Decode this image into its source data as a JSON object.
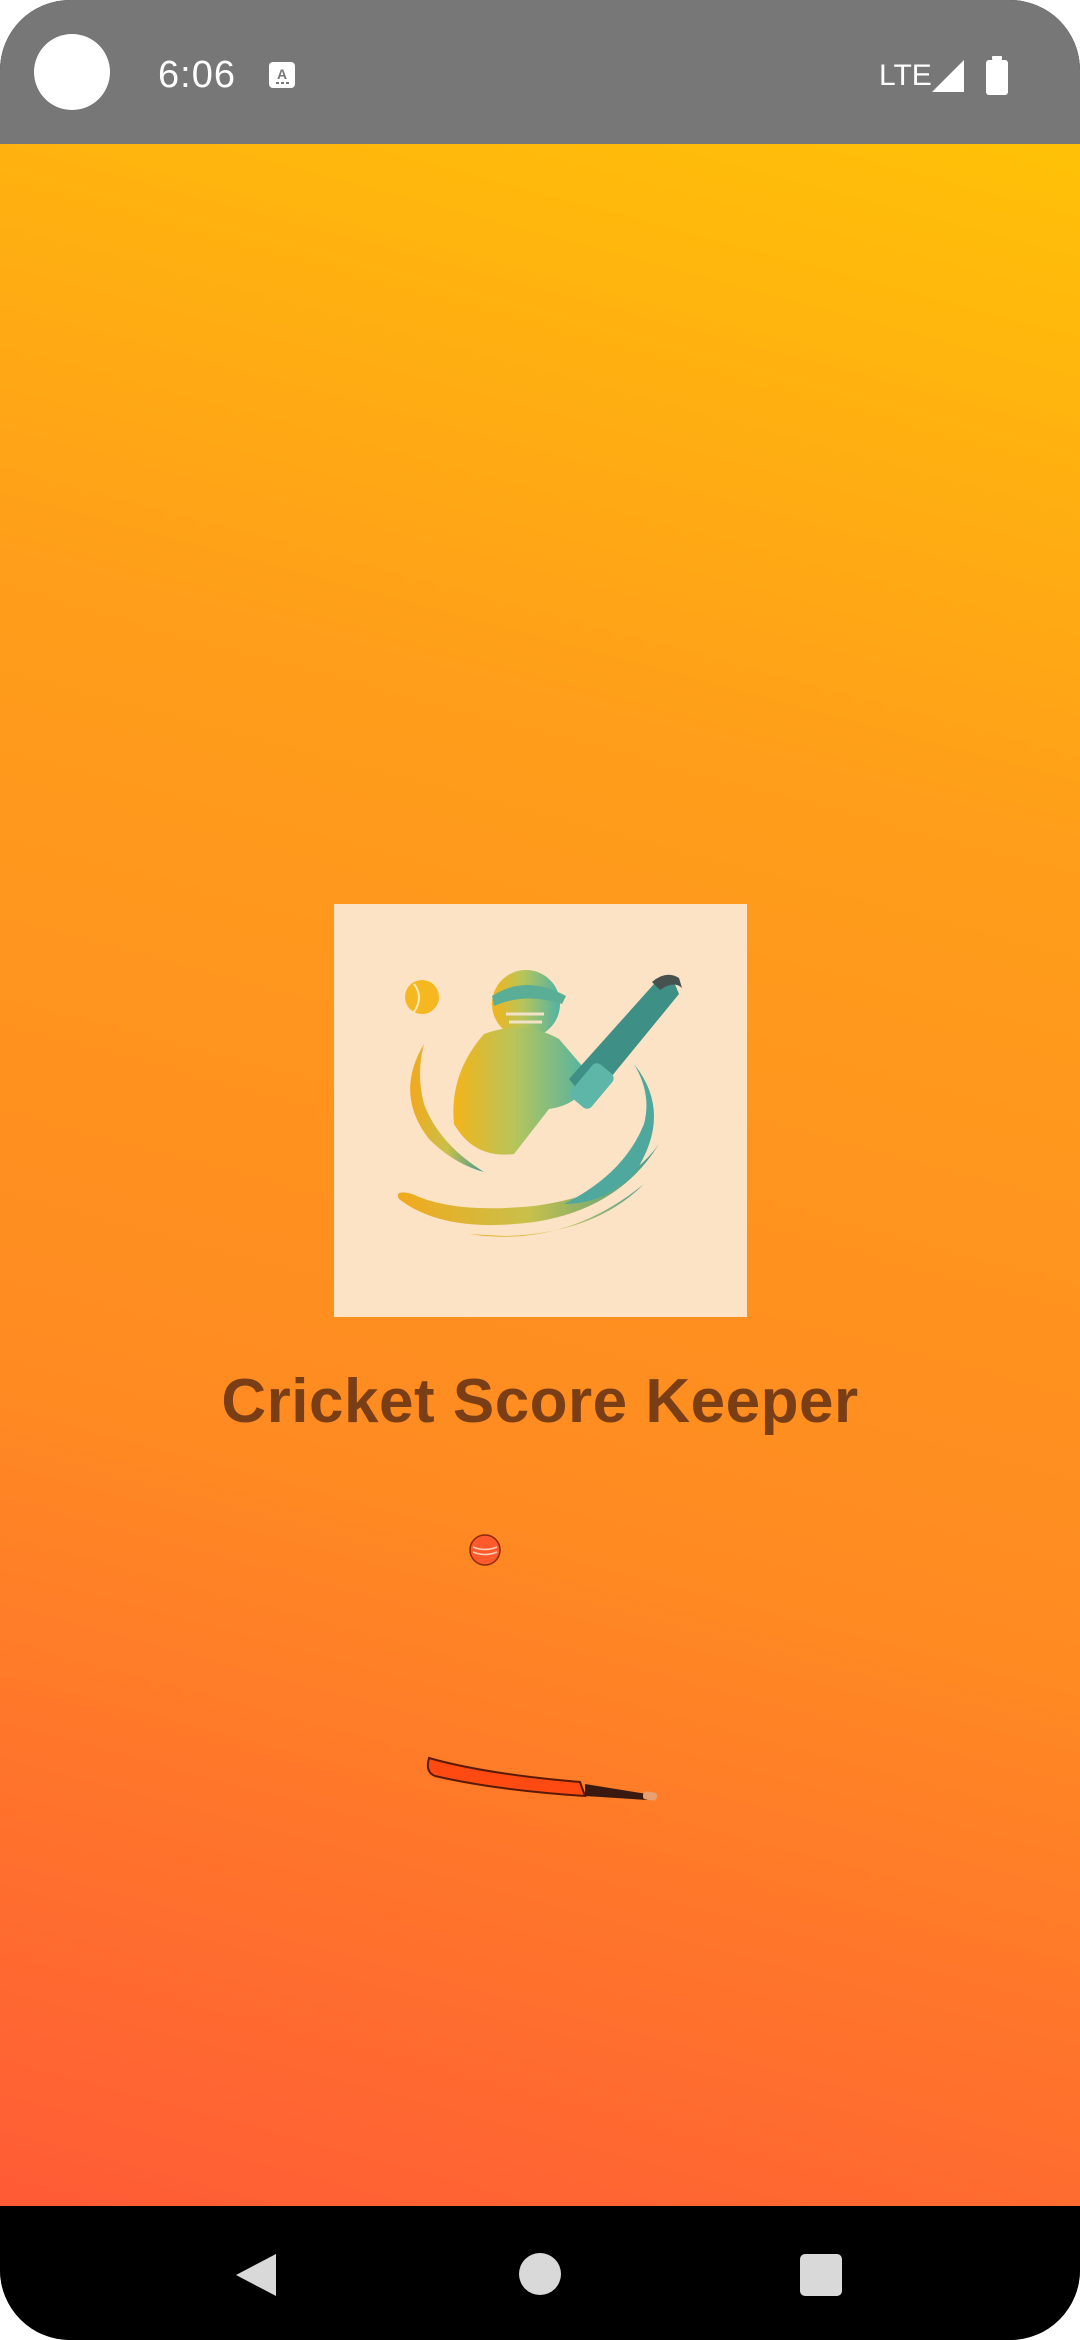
{
  "status_bar": {
    "time": "6:06",
    "notification_icon": "keyboard-a-icon",
    "network": "LTE",
    "signal_icon": "signal-icon",
    "battery_icon": "battery-icon"
  },
  "splash": {
    "logo_icon": "cricket-batsman-logo-icon",
    "title": "Cricket Score Keeper",
    "loader": {
      "ball_icon": "cricket-ball-icon",
      "bat_icon": "cricket-bat-icon"
    }
  },
  "nav_bar": {
    "back_icon": "back-icon",
    "home_icon": "home-icon",
    "recents_icon": "recents-icon"
  },
  "colors": {
    "gradient_top": "#FFC107",
    "gradient_bottom": "#FF5B36",
    "title": "#7A3E16",
    "logo_background": "#FCE3C6"
  }
}
